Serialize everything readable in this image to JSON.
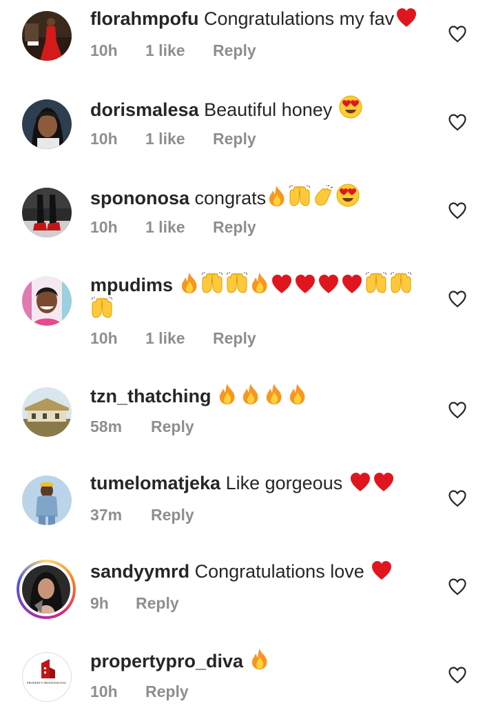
{
  "colors": {
    "username": "#262626",
    "meta": "#8e8e8e",
    "heart_red": "#e0161e",
    "fire": "#f8961e",
    "hands": "#ffc93c"
  },
  "comments": [
    {
      "username": "florahmpofu",
      "text": "Congratulations my fav",
      "emojis": [
        "red-heart"
      ],
      "time": "10h",
      "likes": "1 like",
      "reply": "Reply",
      "avatar": "woman-red-dress"
    },
    {
      "username": "dorismalesa",
      "text": "Beautiful honey",
      "emojis": [
        "heart-eyes"
      ],
      "time": "10h",
      "likes": "1 like",
      "reply": "Reply",
      "avatar": "woman-portrait"
    },
    {
      "username": "spononosa",
      "text": "congrats",
      "emojis": [
        "fire",
        "raising-hands",
        "clapping-hands",
        "heart-eyes"
      ],
      "time": "10h",
      "likes": "1 like",
      "reply": "Reply",
      "avatar": "shoes"
    },
    {
      "username": "mpudims",
      "text": "",
      "emojis": [
        "fire",
        "raising-hands",
        "raising-hands",
        "fire",
        "red-heart",
        "red-heart",
        "red-heart",
        "red-heart",
        "raising-hands",
        "raising-hands",
        "raising-hands"
      ],
      "time": "10h",
      "likes": "1 like",
      "reply": "Reply",
      "avatar": "smiling-woman"
    },
    {
      "username": "tzn_thatching",
      "text": "",
      "emojis": [
        "fire",
        "fire",
        "fire",
        "fire"
      ],
      "time": "58m",
      "likes": "",
      "reply": "Reply",
      "avatar": "thatched-house"
    },
    {
      "username": "tumelomatjeka",
      "text": "Like gorgeous",
      "emojis": [
        "red-heart",
        "red-heart"
      ],
      "time": "37m",
      "likes": "",
      "reply": "Reply",
      "avatar": "man-denim"
    },
    {
      "username": "sandyymrd",
      "text": "Congratulations love",
      "emojis": [
        "red-heart"
      ],
      "time": "9h",
      "likes": "",
      "reply": "Reply",
      "avatar": "woman-dark-hair-story-ring"
    },
    {
      "username": "propertypro_diva",
      "text": "",
      "emojis": [
        "fire"
      ],
      "time": "10h",
      "likes": "",
      "reply": "Reply",
      "avatar": "property-professional-logo",
      "logo_text": "PROPERTY PROFESSIONAL"
    }
  ]
}
